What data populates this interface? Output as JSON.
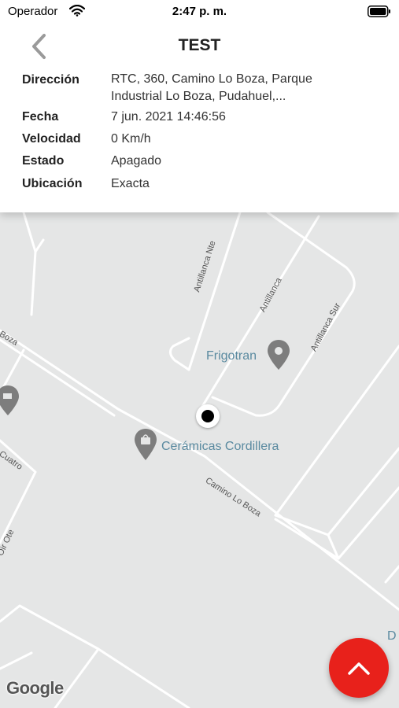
{
  "status_bar": {
    "carrier": "Operador",
    "time": "2:47 p. m.",
    "icons": [
      "wifi-icon",
      "battery-icon"
    ]
  },
  "header": {
    "title": "TEST",
    "back_icon": "chevron-left-icon",
    "rows": [
      {
        "label": "Dirección",
        "value": "RTC, 360, Camino Lo Boza, Parque Industrial Lo Boza, Pudahuel,..."
      },
      {
        "label": "Fecha",
        "value": "7 jun. 2021 14:46:56"
      },
      {
        "label": "Velocidad",
        "value": "0 Km/h"
      },
      {
        "label": "Estado",
        "value": "Apagado"
      },
      {
        "label": "Ubicación",
        "value": "Exacta"
      }
    ]
  },
  "map": {
    "pois": [
      {
        "name": "Frigotran",
        "icon": "location-pin-icon"
      },
      {
        "name": "Cerámicas Cordillera",
        "icon": "shopping-bag-pin-icon"
      }
    ],
    "roads": [
      "Antillanca Nte",
      "Antillanca",
      "Antillanca Sur",
      "Camino Lo Boza",
      "Boza",
      "Cuatro",
      "Oir Ote"
    ],
    "edge_label": "D",
    "logo": "Google",
    "colors": {
      "background": "#e5e6e6",
      "road": "#ffffff",
      "poi_text": "#5a8aa0",
      "poi_pin": "#7a7a7a"
    }
  },
  "fab": {
    "icon": "chevron-up-icon",
    "color": "#e8211b"
  }
}
